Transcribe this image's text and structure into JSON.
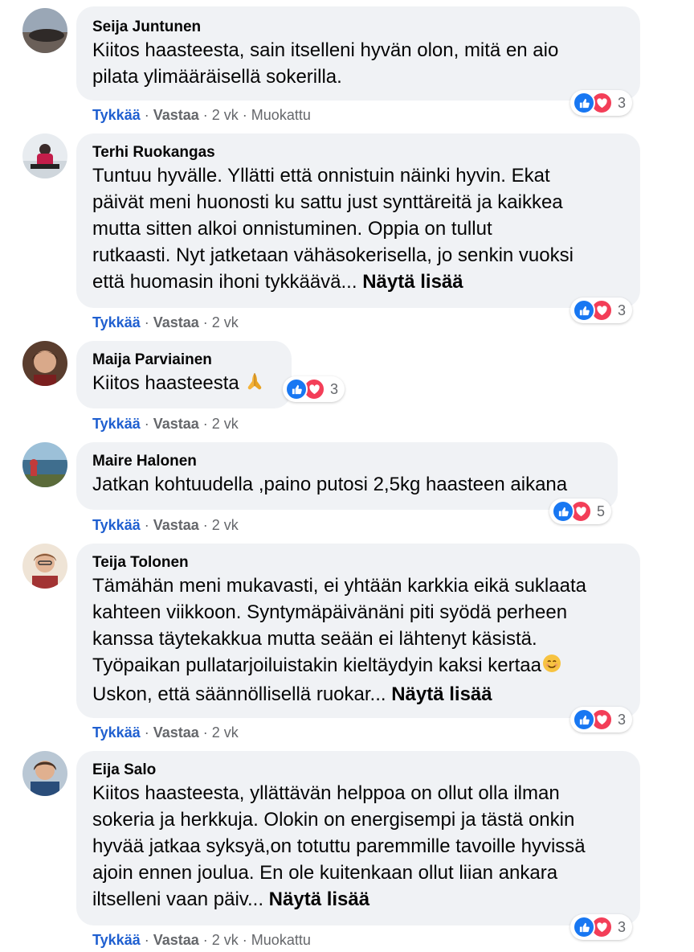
{
  "actions": {
    "like": "Tykkää",
    "reply": "Vastaa",
    "separator": "·"
  },
  "comments": [
    {
      "author": "Seija Juntunen",
      "text": "Kiitos haasteesta, sain itselleni hyvän olon, mitä en aio\npilata ylimääräisellä sokerilla.",
      "time": "2 vk",
      "edited": "Muokattu",
      "reactions": "3"
    },
    {
      "author": "Terhi Ruokangas",
      "text": "Tuntuu hyvälle. Yllätti että onnistuin näinki hyvin. Ekat\npäivät meni huonosti ku sattu just synttäreitä ja kaikkea\nmutta sitten alkoi onnistuminen. Oppia on tullut\nrutkaasti. Nyt jatketaan vähäsokerisella, jo senkin vuoksi\nettä huomasin ihoni tykkäävä...",
      "more": "Näytä lisää",
      "time": "2 vk",
      "reactions": "3"
    },
    {
      "author": "Maija Parviainen",
      "text": "Kiitos haasteesta",
      "emoji": "folded-hands-emoji",
      "time": "2 vk",
      "reactions": "3"
    },
    {
      "author": "Maire Halonen",
      "text": "Jatkan kohtuudella ,paino putosi 2,5kg haasteen aikana",
      "time": "2 vk",
      "reactions": "5"
    },
    {
      "author": "Teija Tolonen",
      "text": "Tämähän meni mukavasti, ei yhtään karkkia eikä suklaata\nkahteen viikkoon. Syntymäpäivänäni piti syödä perheen\nkanssa täytekakkua mutta seään ei lähtenyt käsistä.\nTyöpaikan pullatarjoiluistakin kieltäydyin kaksi kertaa",
      "text_end": "Uskon, että säännöllisellä ruokar...",
      "emoji": "smiling-face-emoji",
      "more": "Näytä lisää",
      "time": "2 vk",
      "reactions": "3"
    },
    {
      "author": "Eija Salo",
      "text": "Kiitos haasteesta, yllättävän helppoa on ollut olla ilman\nsokeria ja herkkuja. Olokin on energisempi ja tästä onkin\nhyvää jatkaa syksyä,on totuttu paremmille tavoille hyvissä\najoin ennen joulua. En ole kuitenkaan ollut liian ankara\niltselleni vaan päiv...",
      "more": "Näytä lisää",
      "time": "2 vk",
      "edited": "Muokattu",
      "reactions": "3"
    }
  ],
  "colors": {
    "like_blue": "#1877f2",
    "love_red": "#f33e58",
    "bubble_bg": "#f0f2f5",
    "meta_gray": "#65676b"
  }
}
